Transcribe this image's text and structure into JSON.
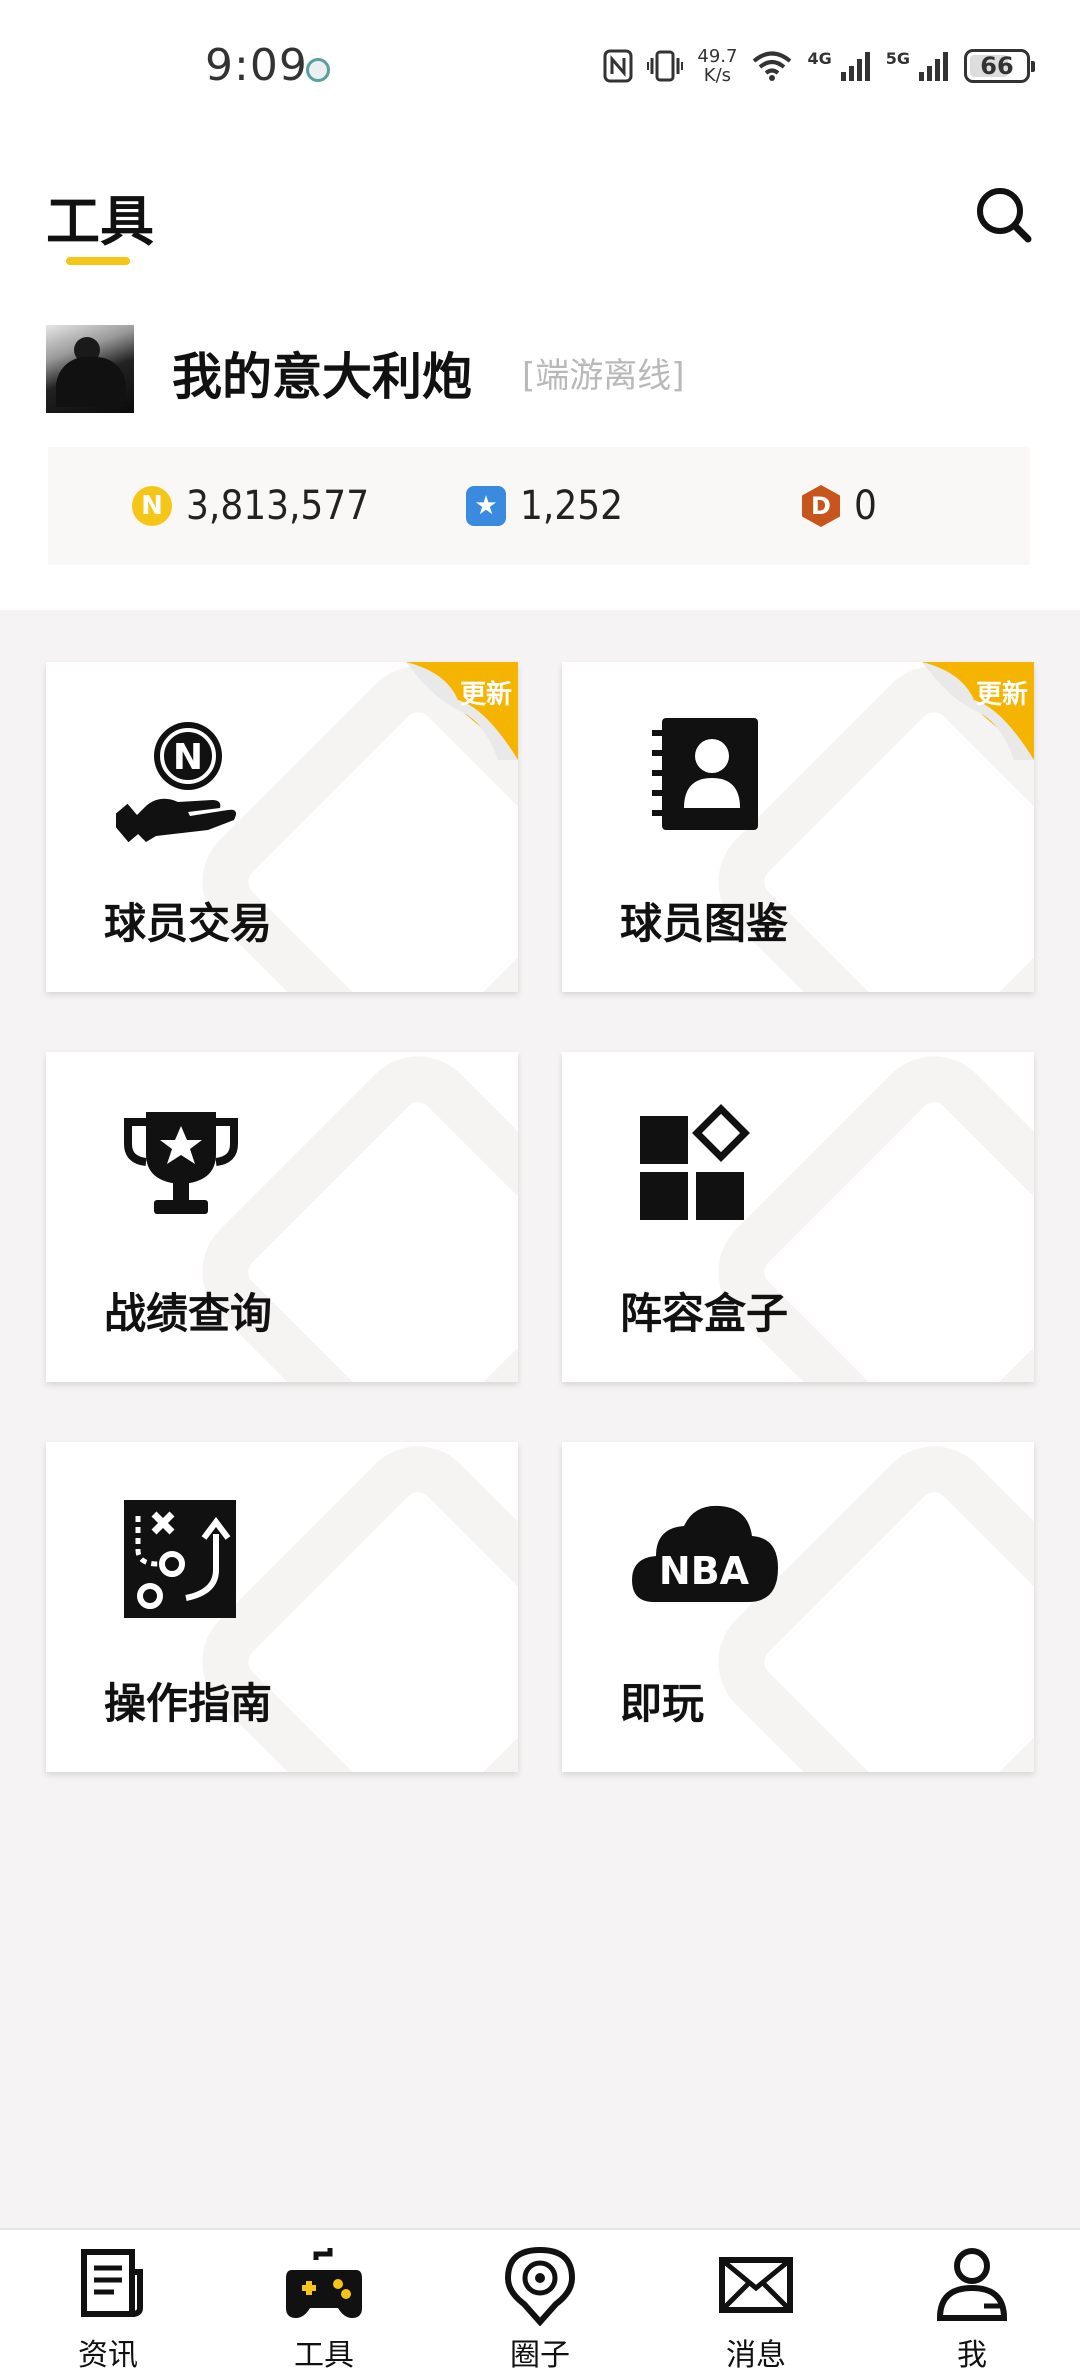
{
  "status_bar": {
    "time": "9:09",
    "speed_value": "49.7",
    "speed_unit": "K/s",
    "net1": "4G",
    "net2": "5G",
    "battery": "66"
  },
  "header": {
    "title": "工具",
    "search_icon": "search-icon"
  },
  "profile": {
    "username": "我的意大利炮",
    "tag": "[端游离线]"
  },
  "currencies": [
    {
      "icon": "n-coin-icon",
      "symbol": "N",
      "value": "3,813,577",
      "color": "#f5c518"
    },
    {
      "icon": "star-badge-icon",
      "symbol": "★",
      "value": "1,252",
      "color": "#3a8be0"
    },
    {
      "icon": "d-badge-icon",
      "symbol": "D",
      "value": "0",
      "color": "#c8551c"
    }
  ],
  "tools": [
    {
      "label": "球员交易",
      "icon": "hand-coin-icon",
      "ribbon": "更新"
    },
    {
      "label": "球员图鉴",
      "icon": "contact-book-icon",
      "ribbon": "更新"
    },
    {
      "label": "战绩查询",
      "icon": "trophy-icon",
      "ribbon": ""
    },
    {
      "label": "阵容盒子",
      "icon": "apps-grid-icon",
      "ribbon": ""
    },
    {
      "label": "操作指南",
      "icon": "tactics-board-icon",
      "ribbon": ""
    },
    {
      "label": "即玩",
      "icon": "nba-cloud-icon",
      "ribbon": ""
    }
  ],
  "bottom_nav": [
    {
      "label": "资讯",
      "icon": "news-icon",
      "active": false
    },
    {
      "label": "工具",
      "icon": "gamepad-icon",
      "active": true
    },
    {
      "label": "圈子",
      "icon": "circle-map-icon",
      "active": false
    },
    {
      "label": "消息",
      "icon": "mail-icon",
      "active": false
    },
    {
      "label": "我",
      "icon": "user-icon",
      "active": false
    }
  ],
  "colors": {
    "accent": "#f5c518",
    "background": "#f5f3f3"
  }
}
